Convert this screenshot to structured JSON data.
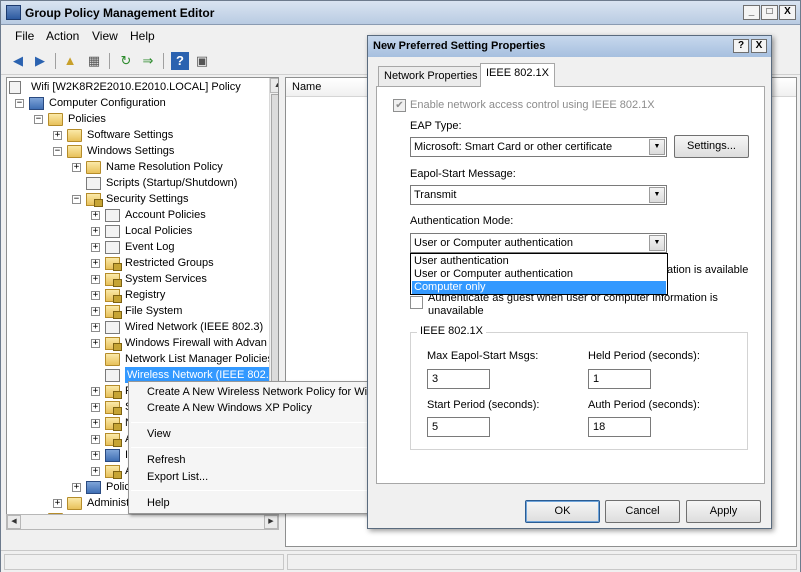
{
  "main_window": {
    "title": "Group Policy Management Editor",
    "controls": {
      "minimize": "_",
      "maximize": "□",
      "close": "X"
    }
  },
  "menu": [
    "File",
    "Action",
    "View",
    "Help"
  ],
  "toolbar": {
    "icons": [
      "back-icon",
      "forward-icon",
      "up-folder-icon",
      "show-hide-tree-icon",
      "refresh-icon",
      "export-icon",
      "help-icon",
      "properties-icon"
    ]
  },
  "tree": {
    "root": "Wifi [W2K8R2E2010.E2010.LOCAL] Policy",
    "items": [
      {
        "label": "Computer Configuration",
        "expander": "−",
        "icon": "computer-icon"
      },
      {
        "label": "Policies",
        "expander": "−",
        "icon": "folder-icon"
      },
      {
        "label": "Software Settings",
        "expander": "+",
        "icon": "folder-icon"
      },
      {
        "label": "Windows Settings",
        "expander": "−",
        "icon": "folder-icon"
      },
      {
        "label": "Name Resolution Policy",
        "expander": "+",
        "icon": "folder-icon"
      },
      {
        "label": "Scripts (Startup/Shutdown)",
        "expander": "",
        "icon": "script-icon"
      },
      {
        "label": "Security Settings",
        "expander": "−",
        "icon": "security-icon"
      },
      {
        "label": "Account Policies",
        "expander": "+",
        "icon": "policy-icon"
      },
      {
        "label": "Local Policies",
        "expander": "+",
        "icon": "policy-icon"
      },
      {
        "label": "Event Log",
        "expander": "+",
        "icon": "policy-icon"
      },
      {
        "label": "Restricted Groups",
        "expander": "+",
        "icon": "lock-folder-icon"
      },
      {
        "label": "System Services",
        "expander": "+",
        "icon": "lock-folder-icon"
      },
      {
        "label": "Registry",
        "expander": "+",
        "icon": "lock-folder-icon"
      },
      {
        "label": "File System",
        "expander": "+",
        "icon": "lock-folder-icon"
      },
      {
        "label": "Wired Network (IEEE 802.3)",
        "expander": "+",
        "icon": "network-icon"
      },
      {
        "label": "Windows Firewall with Advan",
        "expander": "+",
        "icon": "lock-folder-icon"
      },
      {
        "label": "Network List Manager Policies",
        "expander": "",
        "icon": "folder-icon"
      },
      {
        "label": "Wireless Network (IEEE 802.",
        "expander": "",
        "icon": "wireless-icon"
      },
      {
        "label": "P",
        "expander": "+",
        "icon": "lock-folder-icon"
      },
      {
        "label": "S",
        "expander": "+",
        "icon": "lock-folder-icon"
      },
      {
        "label": "N",
        "expander": "+",
        "icon": "lock-folder-icon"
      },
      {
        "label": "A",
        "expander": "+",
        "icon": "lock-folder-icon"
      },
      {
        "label": "I",
        "expander": "+",
        "icon": "shield-icon"
      },
      {
        "label": "A",
        "expander": "+",
        "icon": "lock-folder-icon"
      },
      {
        "label": "Polic",
        "expander": "+",
        "icon": "chart-icon"
      },
      {
        "label": "Administ",
        "expander": "+",
        "icon": "folder-icon"
      },
      {
        "label": "Preferences",
        "expander": "+",
        "icon": "folder-icon"
      }
    ]
  },
  "list_pane": {
    "column_name": "Name"
  },
  "context_menu": {
    "items": [
      "Create A New Wireless Network Policy for Win",
      "Create A New Windows XP Policy",
      "View",
      "Refresh",
      "Export List...",
      "Help"
    ]
  },
  "dialog": {
    "title": "New Preferred Setting Properties",
    "help_button": "?",
    "close_button": "X",
    "tabs": [
      "Network Properties",
      "IEEE 802.1X"
    ],
    "enable_label": "Enable network access control using IEEE 802.1X",
    "eap_type_label": "EAP Type:",
    "eap_type_value": "Microsoft: Smart Card or other certificate",
    "settings_button": "Settings...",
    "eapol_label": "Eapol-Start Message:",
    "eapol_value": "Transmit",
    "auth_mode_label": "Authentication Mode:",
    "auth_mode_value": "User or Computer authentication",
    "auth_mode_options": [
      "User authentication",
      "User or Computer authentication",
      "Computer only"
    ],
    "hidden_checkbox_tail": "ation is available",
    "guest_label_line1": "Authenticate as guest when user or computer information is",
    "guest_label_line2": "unavailable",
    "group_title": "IEEE 802.1X",
    "max_eapol_label": "Max Eapol-Start Msgs:",
    "max_eapol_value": "3",
    "held_period_label": "Held Period (seconds):",
    "held_period_value": "1",
    "start_period_label": "Start Period (seconds):",
    "start_period_value": "5",
    "auth_period_label": "Auth Period (seconds):",
    "auth_period_value": "18",
    "ok_button": "OK",
    "cancel_button": "Cancel",
    "apply_button": "Apply"
  }
}
